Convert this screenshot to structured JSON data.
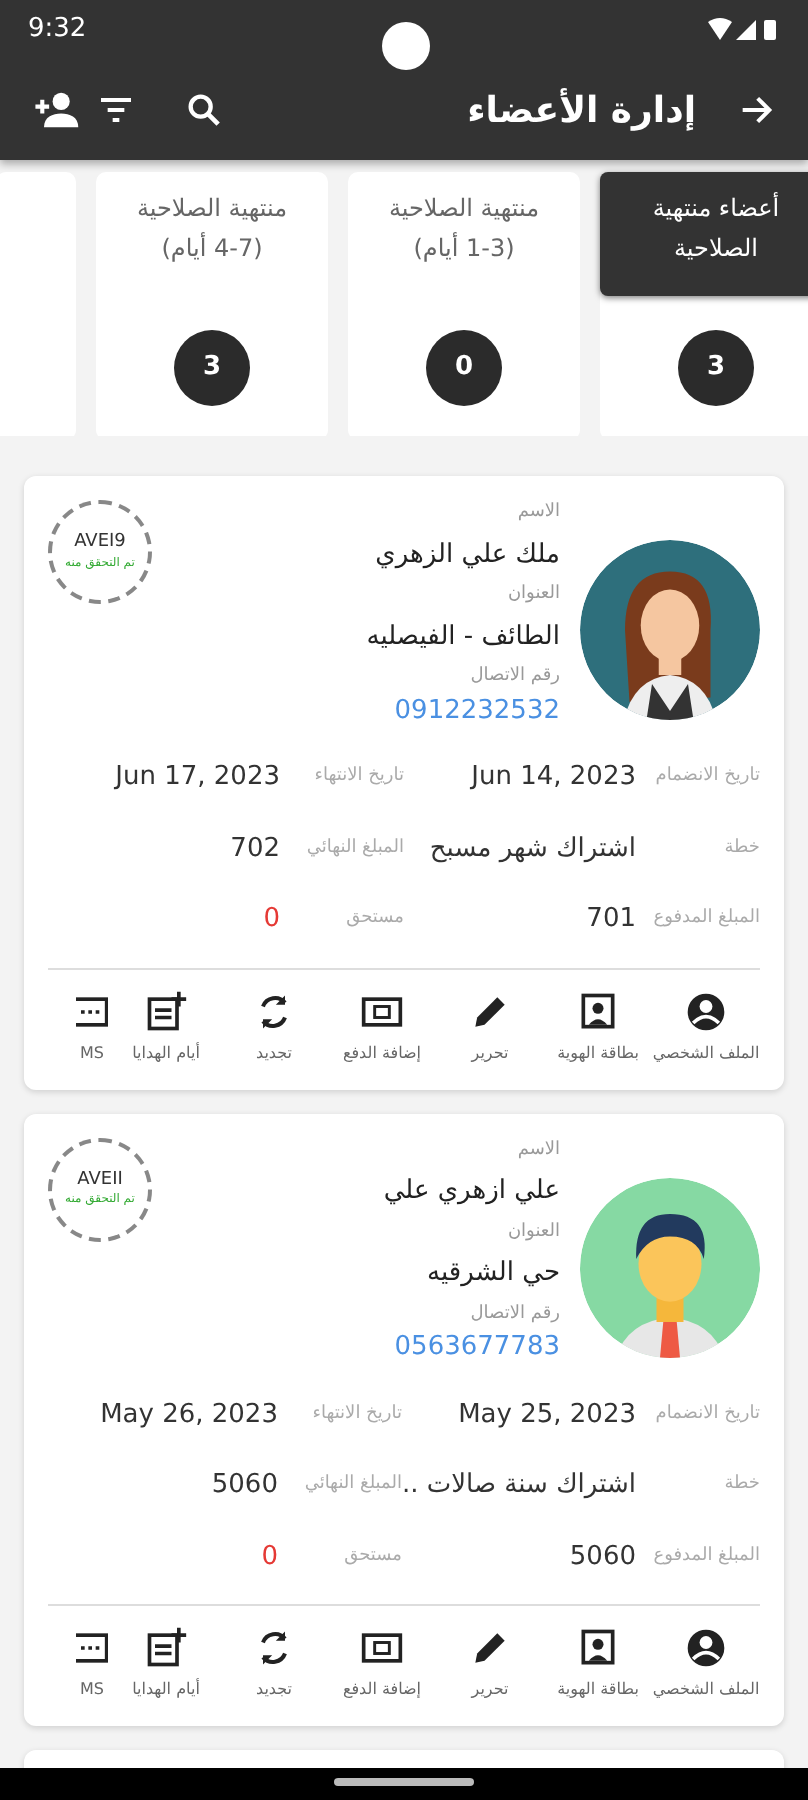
{
  "status_bar": {
    "time": "9:32"
  },
  "app_bar": {
    "title": "إدارة الأعضاء"
  },
  "filters": [
    {
      "label": "أعضاء منتهية الصلاحية",
      "count": "3",
      "selected": true
    },
    {
      "label": "منتهية الصلاحية\n(1-3 أيام)",
      "count": "0",
      "selected": false
    },
    {
      "label": "منتهية الصلاحية\n(4-7 أيام)",
      "count": "3",
      "selected": false
    }
  ],
  "members": [
    {
      "kind": "female",
      "color": "#2e6f7c",
      "stamp_code": "AVEI9",
      "stamp_text": "تم التحقق منه",
      "name_label": "الاسم",
      "name": "ملك علي الزهري",
      "address_label": "العنوان",
      "address": "الطائف - الفيصليه",
      "phone_label": "رقم الاتصال",
      "phone": "0912232532",
      "details": [
        {
          "label": "تاريخ الانضمام",
          "value": "Jun 14, 2023"
        },
        {
          "label": "تاريخ الانتهاء",
          "value": "Jun 17, 2023"
        },
        {
          "label": "خطة",
          "value": "اشتراك شهر مسبح"
        },
        {
          "label": "المبلغ النهائي",
          "value": "702"
        },
        {
          "label": "المبلغ المدفوع",
          "value": "701"
        },
        {
          "label": "مستحق",
          "value": "0",
          "kind": "due"
        }
      ],
      "actions": [
        {
          "kind": "profile",
          "label": "الملف الشخصي"
        },
        {
          "kind": "id",
          "label": "بطاقة الهوية"
        },
        {
          "kind": "edit",
          "label": "تحرير"
        },
        {
          "kind": "payment",
          "label": "إضافة الدفع"
        },
        {
          "kind": "renew",
          "label": "تجديد"
        },
        {
          "kind": "gift",
          "label": "أيام الهدايا"
        },
        {
          "kind": "sms",
          "label": "MS"
        }
      ]
    },
    {
      "kind": "male",
      "color": "#86d9a3",
      "stamp_code": "AVEII",
      "stamp_text": "تم التحقق منه",
      "name_label": "الاسم",
      "name": "علي ازهري علي",
      "address_label": "العنوان",
      "address": "حي الشرقيه",
      "phone_label": "رقم الاتصال",
      "phone": "0563677783",
      "details": [
        {
          "label": "تاريخ الانضمام",
          "value": "May 25, 2023"
        },
        {
          "label": "تاريخ الانتهاء",
          "value": "May 26, 2023"
        },
        {
          "label": "خطة",
          "value": "اشتراك سنة صالات .."
        },
        {
          "label": "المبلغ النهائي",
          "value": "5060"
        },
        {
          "label": "المبلغ المدفوع",
          "value": "5060"
        },
        {
          "label": "مستحق",
          "value": "0",
          "kind": "due"
        }
      ],
      "actions": [
        {
          "kind": "profile",
          "label": "الملف الشخصي"
        },
        {
          "kind": "id",
          "label": "بطاقة الهوية"
        },
        {
          "kind": "edit",
          "label": "تحرير"
        },
        {
          "kind": "payment",
          "label": "إضافة الدفع"
        },
        {
          "kind": "renew",
          "label": "تجديد"
        },
        {
          "kind": "gift",
          "label": "أيام الهدايا"
        },
        {
          "kind": "sms",
          "label": "MS"
        }
      ]
    }
  ]
}
